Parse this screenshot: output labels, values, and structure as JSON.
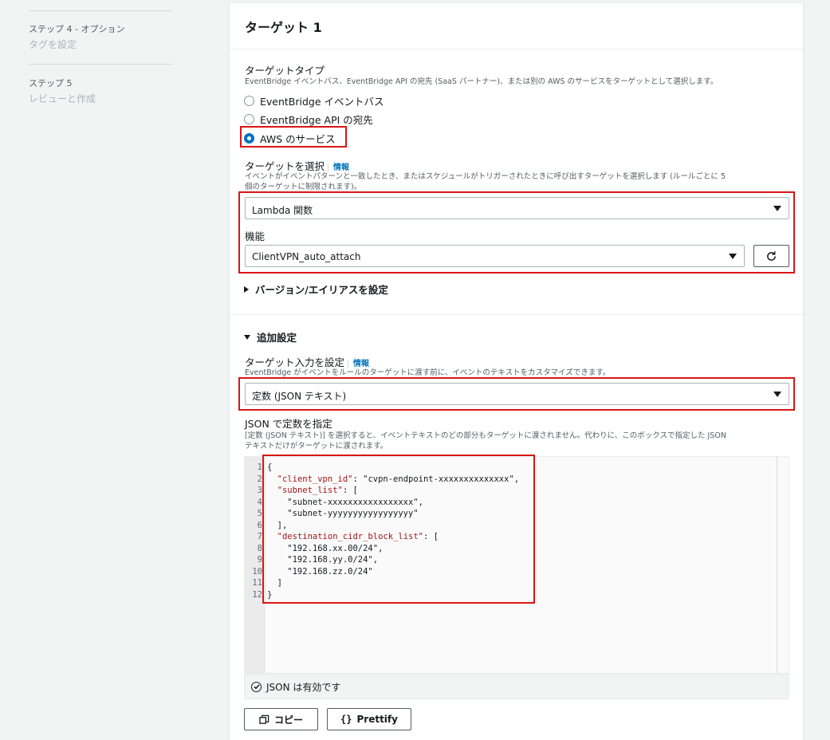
{
  "nav": {
    "step4_label": "ステップ 4 - オプション",
    "step4_title": "タグを設定",
    "step5_label": "ステップ 5",
    "step5_title": "レビューと作成"
  },
  "panel": {
    "title": "ターゲット 1"
  },
  "target_type": {
    "label": "ターゲットタイプ",
    "description": "EventBridge イベントバス、EventBridge API の宛先 (SaaS パートナー)、または別の AWS のサービスをターゲットとして選択します。",
    "options": [
      {
        "label": "EventBridge イベントバス",
        "checked": false
      },
      {
        "label": "EventBridge API の宛先",
        "checked": false
      },
      {
        "label": "AWS のサービス",
        "checked": true
      }
    ]
  },
  "select_target": {
    "label": "ターゲットを選択",
    "info": "情報",
    "description_line1": "イベントがイベントパターンと一致したとき、またはスケジュールがトリガーされたときに呼び出すターゲットを選択します (ルールごとに 5",
    "description_line2": "個のターゲットに制限されます)。",
    "value": "Lambda 関数"
  },
  "function": {
    "label": "機能",
    "value": "ClientVPN_auto_attach",
    "refresh_icon": "refresh-icon"
  },
  "version_alias": {
    "label": "バージョン/エイリアスを設定"
  },
  "additional_settings": {
    "label": "追加設定"
  },
  "target_input": {
    "label": "ターゲット入力を設定",
    "info": "情報",
    "description": "EventBridge がイベントをルールのターゲットに渡す前に、イベントのテキストをカスタマイズできます。",
    "value": "定数 (JSON テキスト)"
  },
  "json_constant": {
    "label": "JSON で定数を指定",
    "description_line1": "[定数 (JSON テキスト)] を選択すると、イベントテキストのどの部分もターゲットに渡されません。代わりに、このボックスで指定した JSON",
    "description_line2": "テキストだけがターゲットに渡されます。"
  },
  "editor": {
    "lines": [
      {
        "n": "1",
        "text": "{"
      },
      {
        "n": "2",
        "key": "\"client_vpn_id\"",
        "rest": ": \"cvpn-endpoint-xxxxxxxxxxxxxx\",",
        "indent": "  "
      },
      {
        "n": "3",
        "key": "\"subnet_list\"",
        "rest": ": [",
        "indent": "  "
      },
      {
        "n": "4",
        "text": "    \"subnet-xxxxxxxxxxxxxxxxx\","
      },
      {
        "n": "5",
        "text": "    \"subnet-yyyyyyyyyyyyyyyyy\""
      },
      {
        "n": "6",
        "text": "  ],"
      },
      {
        "n": "7",
        "key": "\"destination_cidr_block_list\"",
        "rest": ": [",
        "indent": "  "
      },
      {
        "n": "8",
        "text": "    \"192.168.xx.00/24\","
      },
      {
        "n": "9",
        "text": "    \"192.168.yy.0/24\","
      },
      {
        "n": "10",
        "text": "    \"192.168.zz.0/24\""
      },
      {
        "n": "11",
        "text": "  ]"
      },
      {
        "n": "12",
        "text": "}"
      }
    ],
    "status": "JSON は有効です"
  },
  "buttons": {
    "copy": "コピー",
    "prettify": "Prettify"
  },
  "colors": {
    "highlight": "#d91515",
    "link": "#0073bb",
    "radio_selected": "#0073bb"
  }
}
